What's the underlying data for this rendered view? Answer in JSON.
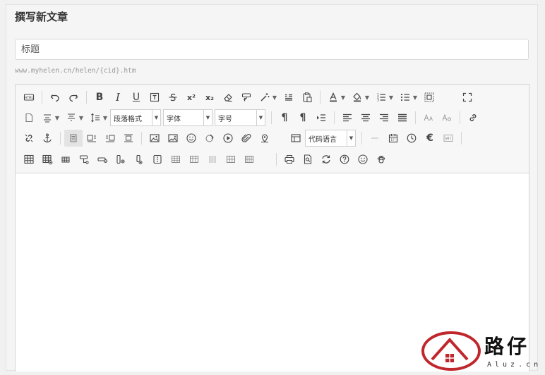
{
  "page": {
    "title": "撰写新文章"
  },
  "title_field": {
    "placeholder": "标题",
    "value": ""
  },
  "permalink": {
    "text": "www.myhelen.cn/helen/{cid}.htm"
  },
  "toolbar": {
    "source_label": "HTML",
    "paragraph_format": "段落格式",
    "font_family": "字体",
    "font_size": "字号",
    "code_language": "代码语言",
    "bold_glyph": "B",
    "italic_glyph": "I",
    "underline_glyph": "U",
    "superscript_glyph": "x²",
    "subscript_glyph": "x₂",
    "text_color_glyph": "A",
    "euro_glyph": "€",
    "ltr_glyph": "¶",
    "rtl_glyph": "¶"
  },
  "watermark": {
    "brand": "路仔",
    "domain": "Aluz.cn",
    "accent_color": "#c0272d"
  },
  "colors": {
    "underline_text_color": "#d33a2c",
    "highlight_color": "#f4c542"
  }
}
